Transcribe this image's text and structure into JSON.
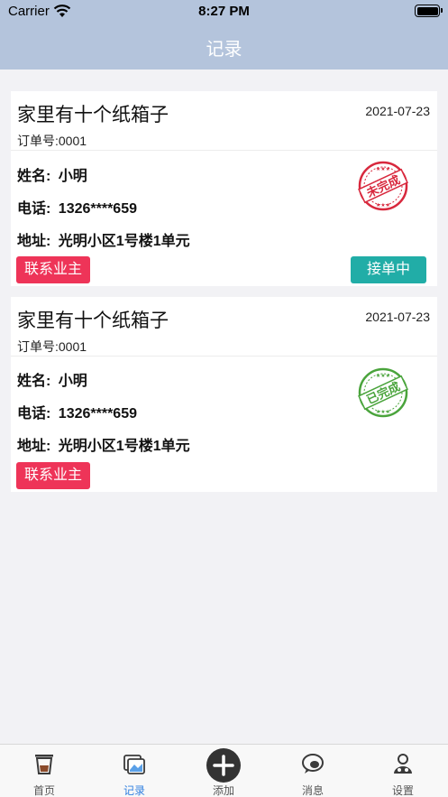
{
  "status": {
    "carrier": "Carrier",
    "time": "8:27 PM"
  },
  "nav": {
    "title": "记录"
  },
  "orders": [
    {
      "title": "家里有十个纸箱子",
      "date": "2021-07-23",
      "order_no": "订单号:0001",
      "name_label": "姓名:",
      "name": "小明",
      "phone_label": "电话:",
      "phone": "1326****659",
      "address_label": "地址:",
      "address": "光明小区1号楼1单元",
      "stamp_text": "未完成",
      "stamp_color": "#d8283d",
      "contact_label": "联系业主",
      "status_button_label": "接单中"
    },
    {
      "title": "家里有十个纸箱子",
      "date": "2021-07-23",
      "order_no": "订单号:0001",
      "name_label": "姓名:",
      "name": "小明",
      "phone_label": "电话:",
      "phone": "1326****659",
      "address_label": "地址:",
      "address": "光明小区1号楼1单元",
      "stamp_text": "已完成",
      "stamp_color": "#4aa43c",
      "contact_label": "联系业主"
    }
  ],
  "tabs": [
    {
      "label": "首页",
      "icon": "home-cup-icon",
      "active": false
    },
    {
      "label": "记录",
      "icon": "records-icon",
      "active": true
    },
    {
      "label": "添加",
      "icon": "add-icon",
      "active": false
    },
    {
      "label": "消息",
      "icon": "message-icon",
      "active": false
    },
    {
      "label": "设置",
      "icon": "settings-user-icon",
      "active": false
    }
  ],
  "colors": {
    "nav_bg": "#b4c4dc",
    "contact_btn": "#ee3458",
    "status_btn": "#21ada7",
    "tab_active": "#2f7fe0"
  }
}
